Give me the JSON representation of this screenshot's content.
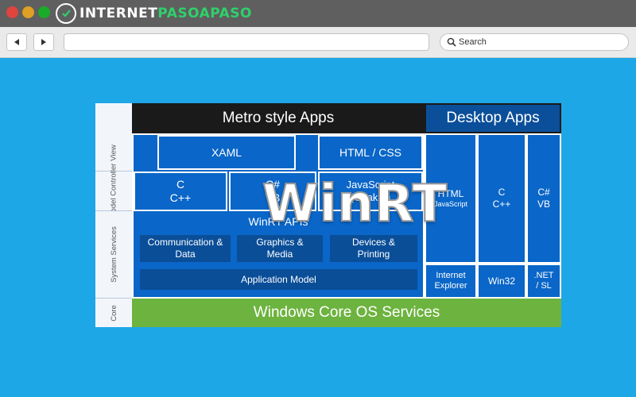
{
  "browser": {
    "logo_text_a": "INTERNET",
    "logo_text_b": "PASOAPASO",
    "search_placeholder": "Search",
    "colors": {
      "close": "#e0443e",
      "minimize": "#dea123",
      "maximize": "#1aab29",
      "logo_accent": "#2fd06b"
    }
  },
  "diagram": {
    "layers": [
      "View",
      "Model Controller",
      "System Services",
      "Core"
    ],
    "metro_header": "Metro style Apps",
    "desktop_header": "Desktop Apps",
    "xaml": "XAML",
    "html_css": "HTML / CSS",
    "c_cpp_l1": "C",
    "c_cpp_l2": "C++",
    "csharp_l1": "C#",
    "csharp_l2": "VB",
    "js_l1": "JavaScript",
    "js_l2": "(Chakra)",
    "winrt_apis": "WinRT APIs",
    "communication": "Communication & Data",
    "graphics": "Graphics & Media",
    "devices": "Devices & Printing",
    "app_model": "Application Model",
    "desk_html_l1": "HTML",
    "desk_html_l2": "JavaScript",
    "desk_c_l1": "C",
    "desk_c_l2": "C++",
    "desk_cs_l1": "C#",
    "desk_cs_l2": "VB",
    "ie": "Internet Explorer",
    "win32": "Win32",
    "net": ".NET / SL",
    "core": "Windows Core OS Services",
    "overlay": "WinRT",
    "colors": {
      "metro_header": "#1a1a1a",
      "desktop_header": "#0b4f9a",
      "app_blue": "#0a66c8",
      "sub_blue": "#0a4e98",
      "core_green": "#6db33f"
    }
  }
}
